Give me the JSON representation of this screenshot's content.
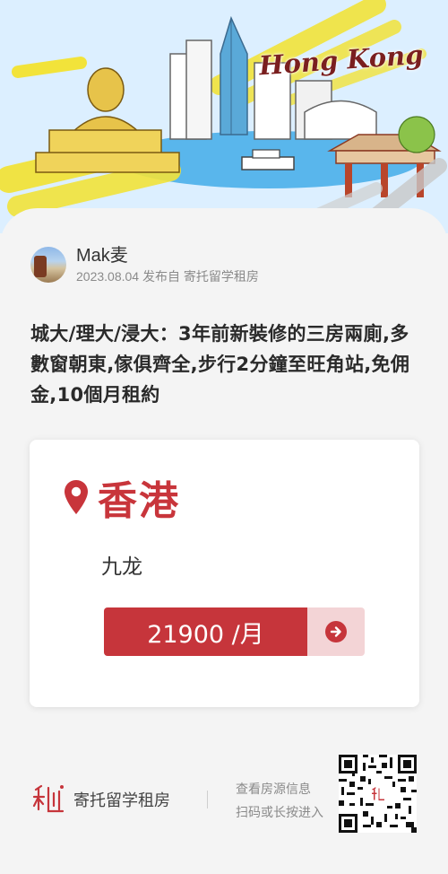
{
  "banner": {
    "title": "Hong Kong",
    "illustration": "hong-kong-skyline-illustration"
  },
  "author": {
    "name": "Mak麦",
    "meta": "2023.08.04 发布自 寄托留学租房"
  },
  "post": {
    "title": "城大/理大/浸大：3年前新裝修的三房兩廁,多數窗朝東,傢俱齊全,步行2分鐘至旺角站,免佣金,10個月租約"
  },
  "location": {
    "icon": "location-pin-icon",
    "city": "香港",
    "district": "九龙",
    "price": "21900 /月",
    "go_icon": "arrow-right-circle-icon"
  },
  "footer": {
    "logo_icon": "jituo-logo-icon",
    "brand": "寄托留学租房",
    "hint_line1": "查看房源信息",
    "hint_line2": "扫码或长按进入"
  },
  "colors": {
    "accent_red": "#c6353b",
    "accent_pink": "#f3d4d6",
    "background": "#f4f4f4",
    "banner_sky": "#dcefff"
  }
}
